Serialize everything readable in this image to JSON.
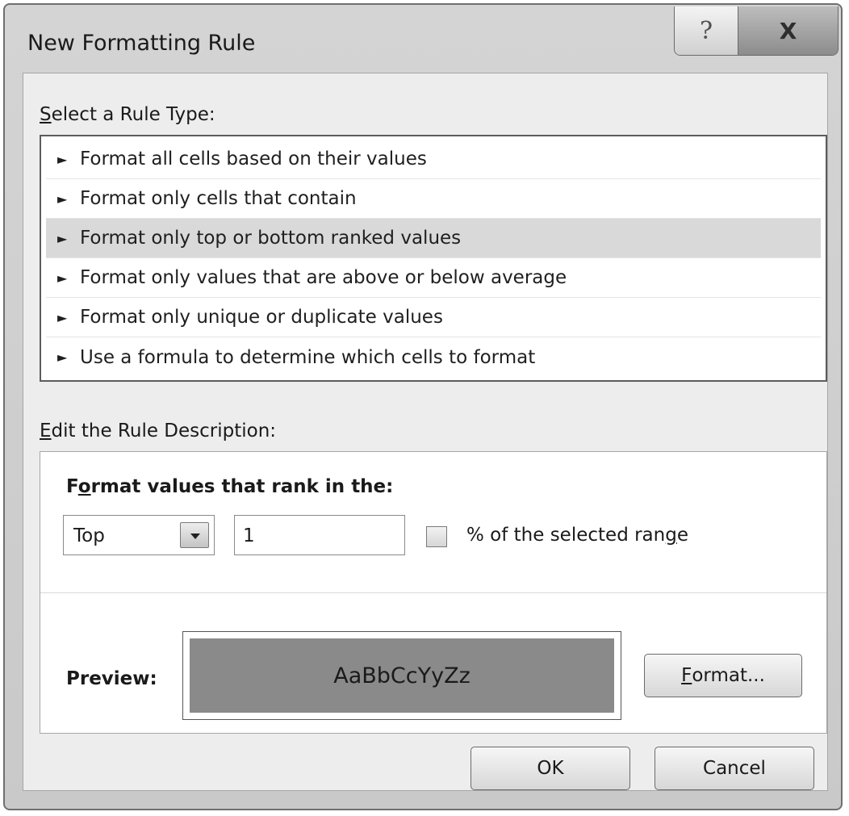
{
  "window": {
    "title": "New Formatting Rule",
    "help_glyph": "?",
    "close_glyph": "X"
  },
  "rule_type": {
    "label_mnemonic": "S",
    "label_rest": "elect a Rule Type:",
    "bullet": "►",
    "items": [
      {
        "label": "Format all cells based on their values",
        "selected": false
      },
      {
        "label": "Format only cells that contain",
        "selected": false
      },
      {
        "label": "Format only top or bottom ranked values",
        "selected": true
      },
      {
        "label": "Format only values that are above or below average",
        "selected": false
      },
      {
        "label": "Format only unique or duplicate values",
        "selected": false
      },
      {
        "label": "Use a formula to determine which cells to format",
        "selected": false
      }
    ]
  },
  "description": {
    "label_mnemonic": "E",
    "label_rest": "dit the Rule Description:",
    "heading_pre": "F",
    "heading_mnemonic": "o",
    "heading_rest": "rmat values that rank in the:",
    "rank_select_value": "Top",
    "rank_count_value": "1",
    "percent_checked": false,
    "percent_label_pre": "% of the selected ran",
    "percent_label_mnemonic": "g",
    "percent_label_post": "e",
    "preview_label": "Preview:",
    "preview_text": "AaBbCcYyZz",
    "preview_fill_color": "#8a8a8a",
    "format_button_mnemonic": "F",
    "format_button_rest": "ormat..."
  },
  "buttons": {
    "ok": "OK",
    "cancel": "Cancel"
  }
}
